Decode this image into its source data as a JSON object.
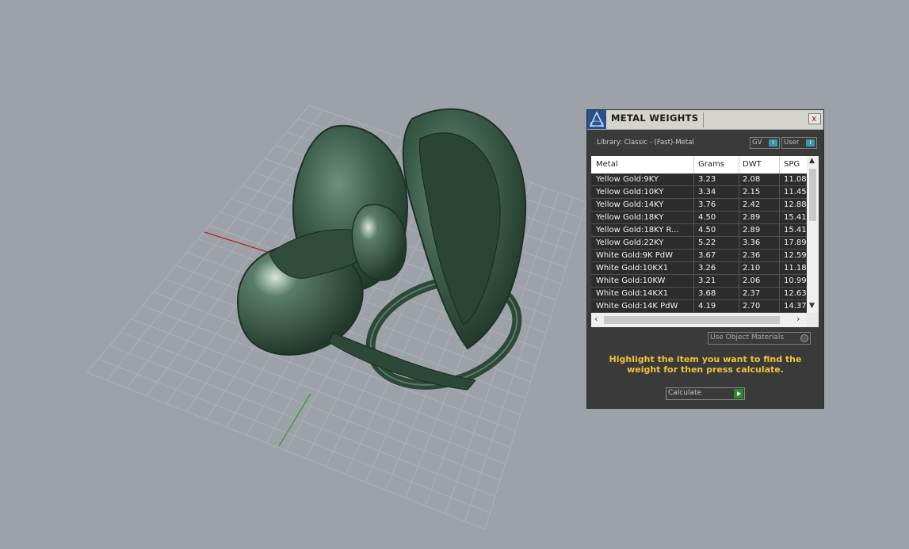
{
  "dialog": {
    "title": "METAL WEIGHTS",
    "close_label": "x",
    "library_label": "Library: Classic - (Fast)-Metal",
    "gv_toggle_label": "GV",
    "user_toggle_label": "User",
    "toggle_knob": "I",
    "use_object_materials_label": "Use Object Materials",
    "hint": "Highlight the item you want to find the weight for then press calculate.",
    "calculate_label": "Calculate"
  },
  "table": {
    "columns": [
      "Metal",
      "Grams",
      "DWT",
      "SPG"
    ],
    "rows": [
      {
        "metal": "Yellow Gold:9KY",
        "grams": "3.23",
        "dwt": "2.08",
        "spg": "11.08"
      },
      {
        "metal": "Yellow Gold:10KY",
        "grams": "3.34",
        "dwt": "2.15",
        "spg": "11.45"
      },
      {
        "metal": "Yellow Gold:14KY",
        "grams": "3.76",
        "dwt": "2.42",
        "spg": "12.88"
      },
      {
        "metal": "Yellow Gold:18KY",
        "grams": "4.50",
        "dwt": "2.89",
        "spg": "15.41"
      },
      {
        "metal": "Yellow Gold:18KY R...",
        "grams": "4.50",
        "dwt": "2.89",
        "spg": "15.41"
      },
      {
        "metal": "Yellow Gold:22KY",
        "grams": "5.22",
        "dwt": "3.36",
        "spg": "17.89"
      },
      {
        "metal": "White Gold:9K PdW",
        "grams": "3.67",
        "dwt": "2.36",
        "spg": "12.59"
      },
      {
        "metal": "White Gold:10KX1",
        "grams": "3.26",
        "dwt": "2.10",
        "spg": "11.18"
      },
      {
        "metal": "White Gold:10KW",
        "grams": "3.21",
        "dwt": "2.06",
        "spg": "10.99"
      },
      {
        "metal": "White Gold:14KX1",
        "grams": "3.68",
        "dwt": "2.37",
        "spg": "12.63"
      },
      {
        "metal": "White Gold:14K PdW",
        "grams": "4.19",
        "dwt": "2.70",
        "spg": "14.37"
      }
    ]
  },
  "colors": {
    "viewport_bg": "#9da2a8",
    "model_green": "#3b5c4a",
    "accent_teal": "#3c9aa5",
    "hint_text": "#f0c23a",
    "go_green": "#2a8a2a"
  }
}
